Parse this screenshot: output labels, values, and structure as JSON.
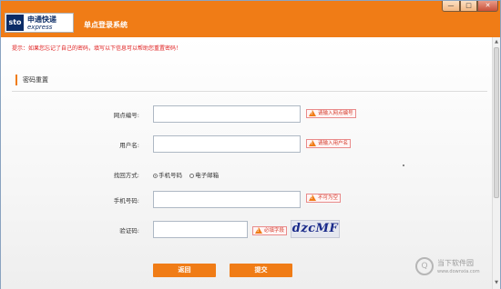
{
  "window": {
    "title": "单点登录系统",
    "controls": {
      "minimize": "—",
      "maximize": "□",
      "close": "✕"
    }
  },
  "logo": {
    "mark": "sto",
    "name_cn": "申通快递",
    "name_en": "express"
  },
  "hint": "提示：如果您忘记了自己的密码，填写以下信息可以帮助您重置密码！",
  "section": {
    "title": "密码重置"
  },
  "form": {
    "branch_code": {
      "label": "网点编号:",
      "value": "",
      "tip": "请输入网点编号"
    },
    "username": {
      "label": "用户名:",
      "value": "",
      "tip": "请输入用户名"
    },
    "recover_method": {
      "label": "找回方式:",
      "options": [
        "手机号码",
        "电子邮箱"
      ],
      "selected": "手机号码"
    },
    "phone": {
      "label": "手机号码:",
      "value": "",
      "tip": "不可为空"
    },
    "captcha": {
      "label": "验证码:",
      "value": "",
      "tip": "必填字段",
      "image_text": "dzcMF"
    }
  },
  "buttons": {
    "back": "返回",
    "submit": "提交"
  },
  "watermark": {
    "icon": "Q",
    "cn": "当下软件园",
    "en": "www.downxia.com"
  },
  "colors": {
    "accent": "#f07c16",
    "error": "#e02020",
    "brand_navy": "#0b2c66"
  }
}
